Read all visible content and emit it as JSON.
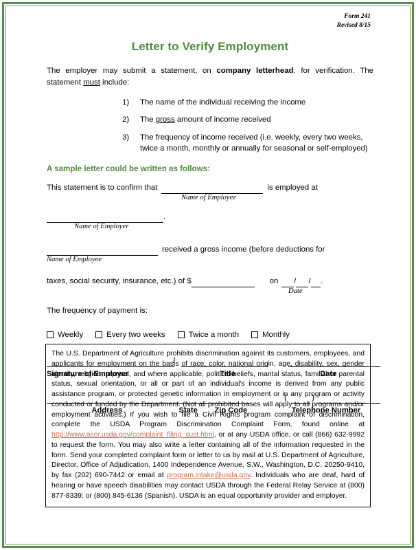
{
  "form": {
    "number": "Form 241",
    "revised": "Revised 8/15"
  },
  "title": "Letter to Verify Employment",
  "intro": {
    "part1": "The employer may submit a statement, on ",
    "bold": "company letterhead",
    "part2": ", for verification.  The statement ",
    "underline": "must",
    "part3": " include:"
  },
  "requirements": [
    {
      "num": "1)",
      "text": "The name of the individual receiving the income"
    },
    {
      "num": "2)",
      "text_pre": "The ",
      "text_underline": "gross",
      "text_post": " amount of income received"
    },
    {
      "num": "3)",
      "text": "The frequency of income received (i.e. weekly, every two weeks, twice a month, monthly or annually for seasonal or self-employed)"
    }
  ],
  "sample_heading": "A sample letter could be written as follows:",
  "letter": {
    "line1_pre": "This statement is to confirm that",
    "line1_post": "is employed at",
    "caption_employee_1": "Name of Employee",
    "caption_employer": "Name of Employer",
    "period": ".",
    "caption_employee_2": "Name of Employee",
    "line3_post": "received a gross income (before deductions for",
    "line4_pre": "taxes, social security, insurance, etc.) of $",
    "line4_on": "on",
    "caption_date": "Date",
    "frequency_label": "The frequency of payment is:"
  },
  "checkboxes": [
    {
      "label": "Weekly"
    },
    {
      "label": "Every two weeks"
    },
    {
      "label": "Twice a month"
    },
    {
      "label": "Monthly"
    }
  ],
  "signature": {
    "employer": "Signature of Employer",
    "title": "Title",
    "date": "Date",
    "address": "Address",
    "state": "State",
    "zip": "Zip Code",
    "telephone": "Telephone Number"
  },
  "disclaimer": {
    "p1": "The U.S. Department of Agriculture prohibits discrimination against its customers, employees, and applicants for employment on the basis of race, color, national origin, age, disability, sex, gender identity, religion, reprisal, and where applicable, political beliefs, marital status, familial or parental status, sexual orientation, or all or part of an individual's income is derived from any public assistance program, or protected genetic information in employment or in any program or activity conducted or funded by the Department. (Not all prohibited bases will apply to all programs and/or employment activities.)  If you wish to file a Civil Rights program complaint of discrimination, complete the USDA Program Discrimination Complaint Form, found online at ",
    "url": "http://www.ascr.usda.gov/complaint_filing_cust.html",
    "p2": ", or at any USDA office, or call (866) 632-9992 to request the form.  You may also write a letter containing all of the information requested in the form.  Send your completed complaint form or letter to us by mail at U.S. Department of Agriculture, Director, Office of Adjudication, 1400 Independence Avenue, S.W., Washington, D.C. 20250-9410, by fax (202) 690-7442 or email at ",
    "email": "program.intake@usda.gov",
    "p3": ".  Individuals who are deaf, hard of hearing or have speech disabilities may contact USDA through the Federal Relay Service at (800) 877-8339; or (800) 845-6136 (Spanish).   USDA is an equal opportunity provider and employer."
  },
  "colors": {
    "border_green": "#5a8a4a",
    "heading_green": "#4f8a3d",
    "link": "#d06b4a"
  }
}
